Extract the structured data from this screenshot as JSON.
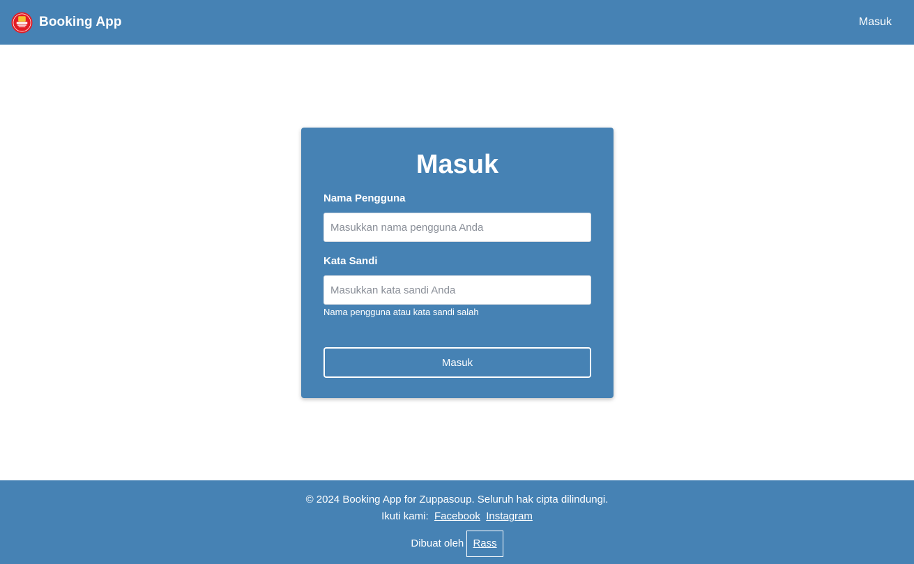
{
  "navbar": {
    "brand": "Booking App",
    "logo_icon": "zuppasoup-logo-icon",
    "login_link": "Masuk"
  },
  "login": {
    "title": "Masuk",
    "username_label": "Nama Pengguna",
    "username_placeholder": "Masukkan nama pengguna Anda",
    "password_label": "Kata Sandi",
    "password_placeholder": "Masukkan kata sandi Anda",
    "error_message": "Nama pengguna atau kata sandi salah",
    "submit_label": "Masuk"
  },
  "footer": {
    "copyright": "© 2024 Booking App for Zuppasoup. Seluruh hak cipta dilindungi.",
    "follow_label": "Ikuti kami:",
    "facebook": "Facebook",
    "instagram": "Instagram",
    "made_by_label": "Dibuat oleh",
    "author": "Rass"
  },
  "colors": {
    "primary": "#4682b4",
    "white": "#ffffff",
    "logo_red": "#e31b23"
  }
}
